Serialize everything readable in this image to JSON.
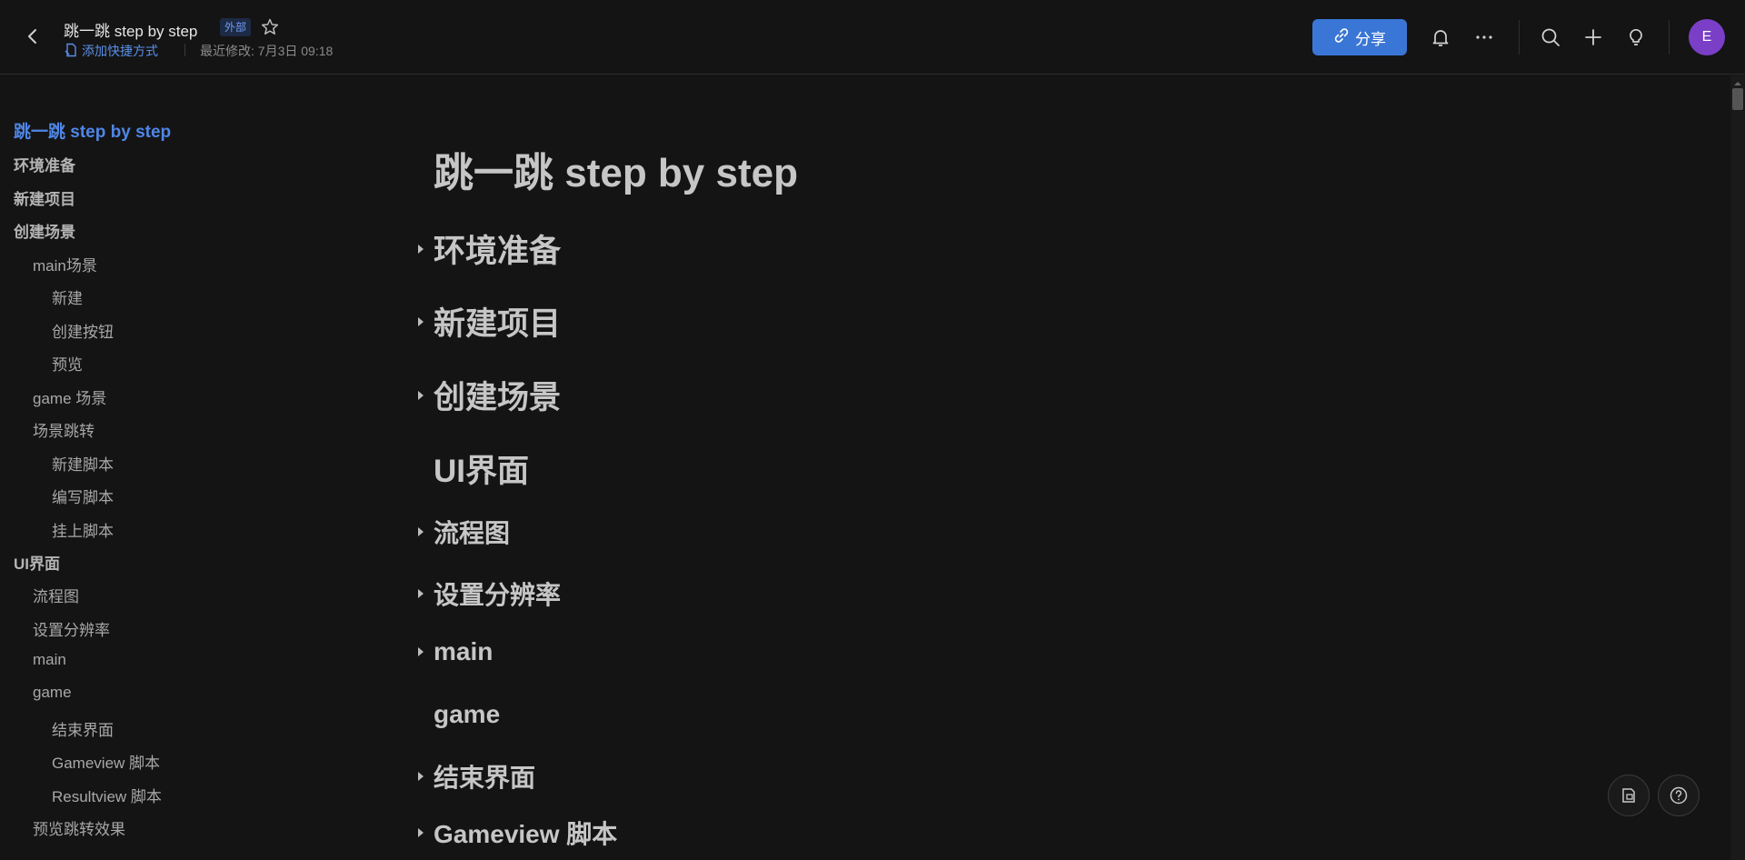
{
  "header": {
    "title": "跳一跳 step by step",
    "badge": "外部",
    "shortcut_label": "添加快捷方式",
    "last_modified": "最近修改: 7月3日 09:18",
    "share_label": "分享",
    "avatar_letter": "E"
  },
  "colors": {
    "accent": "#3a76d6",
    "link": "#5b8fe8",
    "avatar": "#7a3fc6",
    "background": "#141414"
  },
  "icons": [
    "back-arrow-icon",
    "star-icon",
    "shortcut-icon",
    "link-icon",
    "bell-icon",
    "more-icon",
    "search-icon",
    "plus-icon",
    "bulb-icon",
    "feedback-icon",
    "help-icon"
  ],
  "toc": [
    {
      "label": "跳一跳 step by step",
      "level": 1,
      "active": true
    },
    {
      "label": "环境准备",
      "level": 1
    },
    {
      "label": "新建项目",
      "level": 1
    },
    {
      "label": "创建场景",
      "level": 1
    },
    {
      "label": "main场景",
      "level": 2
    },
    {
      "label": "新建",
      "level": 3
    },
    {
      "label": "创建按钮",
      "level": 3
    },
    {
      "label": "预览",
      "level": 3
    },
    {
      "label": "game 场景",
      "level": 2
    },
    {
      "label": "场景跳转",
      "level": 2
    },
    {
      "label": "新建脚本",
      "level": 3
    },
    {
      "label": "编写脚本",
      "level": 3
    },
    {
      "label": "挂上脚本",
      "level": 3
    },
    {
      "label": "UI界面",
      "level": 1
    },
    {
      "label": "流程图",
      "level": 2
    },
    {
      "label": "设置分辨率",
      "level": 2
    },
    {
      "label": "main",
      "level": 2
    },
    {
      "label": "game",
      "level": 2
    },
    {
      "label": "结束界面",
      "level": 3
    },
    {
      "label": "Gameview 脚本",
      "level": 3
    },
    {
      "label": "Resultview 脚本",
      "level": 3
    },
    {
      "label": "预览跳转效果",
      "level": 2
    }
  ],
  "document": {
    "title": "跳一跳 step by step",
    "sections": [
      {
        "label": "环境准备",
        "collapsed": true,
        "level": 2
      },
      {
        "label": "新建项目",
        "collapsed": true,
        "level": 2
      },
      {
        "label": "创建场景",
        "collapsed": true,
        "level": 2
      },
      {
        "label": "UI界面",
        "collapsed": false,
        "level": 2
      },
      {
        "label": "流程图",
        "collapsed": true,
        "level": 3
      },
      {
        "label": "设置分辨率",
        "collapsed": true,
        "level": 3
      },
      {
        "label": "main",
        "collapsed": true,
        "level": 3
      },
      {
        "label": "game",
        "collapsed": false,
        "level": 3
      },
      {
        "label": "结束界面",
        "collapsed": true,
        "level": 3
      },
      {
        "label": "Gameview 脚本",
        "collapsed": true,
        "level": 3
      }
    ]
  }
}
